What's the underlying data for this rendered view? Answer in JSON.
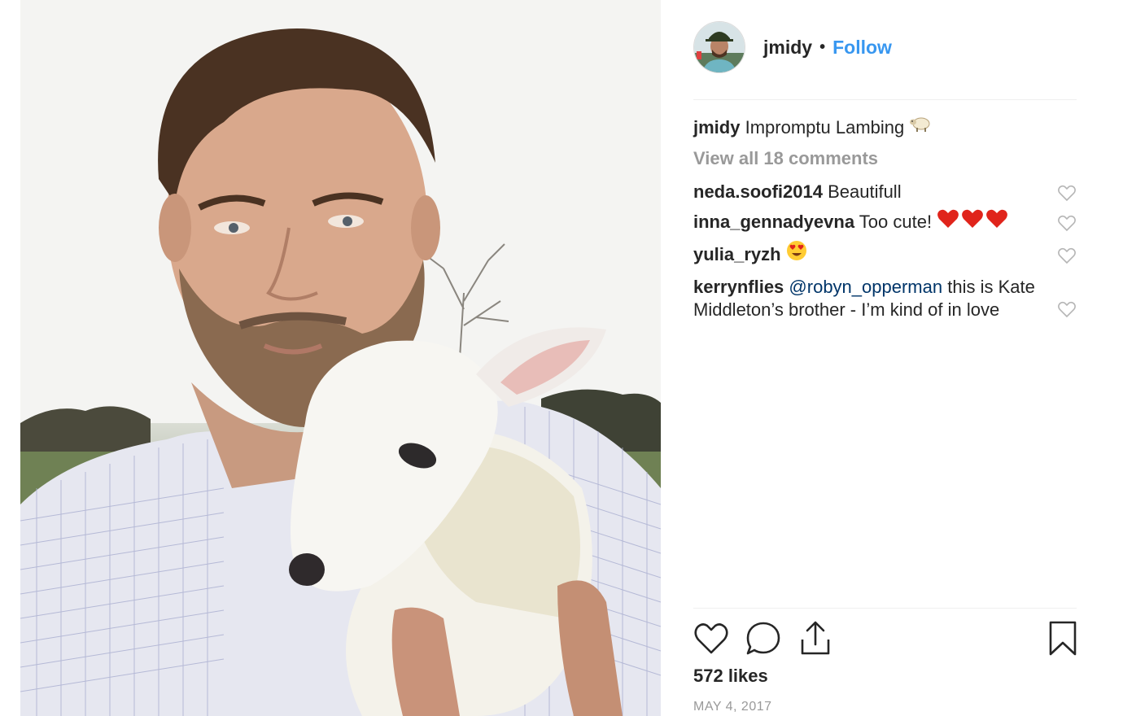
{
  "post": {
    "username": "jmidy",
    "separator": "•",
    "follow_label": "Follow",
    "caption_user": "jmidy",
    "caption_text": "Impromptu Lambing",
    "caption_emoji_icon": "sheep-icon",
    "view_all_label": "View all 18 comments",
    "comments": [
      {
        "user": "neda.soofi2014",
        "text": "Beautifull"
      },
      {
        "user": "inna_gennadyevna",
        "text": "Too cute!",
        "emoji_icon": "three-red-hearts-icon"
      },
      {
        "user": "yulia_ryzh",
        "text": "",
        "emoji_icon": "heart-eyes-emoji-icon"
      },
      {
        "user": "kerrynflies",
        "mention": "@robyn_opperman",
        "text": "this is Kate Middleton’s brother - I’m kind of in love"
      }
    ],
    "likes": "572 likes",
    "date": "MAY 4, 2017"
  },
  "icons": {
    "like": "heart-icon",
    "comment": "comment-bubble-icon",
    "share": "share-upload-icon",
    "save": "bookmark-icon",
    "comment_like": "small-heart-icon"
  },
  "colors": {
    "follow": "#3897f0",
    "mention": "#003569",
    "text": "#262626",
    "muted": "#999999",
    "heart_red": "#e0241b"
  }
}
